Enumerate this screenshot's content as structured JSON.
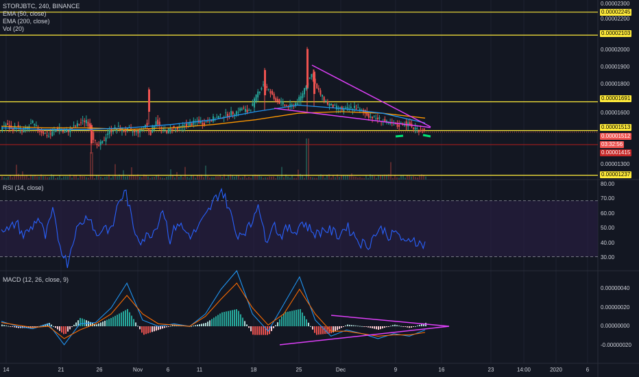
{
  "header": {
    "symbol_line": "STORJBTC, 240, BINANCE",
    "indicators": [
      "EMA (50, close)",
      "EMA (200, close)",
      "Vol (20)"
    ]
  },
  "panes": {
    "rsi_label": "RSI (14, close)",
    "macd_label": "MACD (12, 26, close, 9)"
  },
  "price_axis": {
    "ticks": [
      "0.00002300",
      "0.00002200",
      "0.00002000",
      "0.00001900",
      "0.00001800",
      "0.00001600",
      "0.00001300"
    ],
    "badges": [
      {
        "text": "0.00002245",
        "kind": "level"
      },
      {
        "text": "0.00002103",
        "kind": "level"
      },
      {
        "text": "0.00001691",
        "kind": "level"
      },
      {
        "text": "0.00001513",
        "kind": "level"
      },
      {
        "text": "0.00001512",
        "kind": "price"
      },
      {
        "text": "03:32:56",
        "kind": "price"
      },
      {
        "text": "0.00001415",
        "kind": "price"
      },
      {
        "text": "0.00001237",
        "kind": "level"
      }
    ]
  },
  "rsi_axis": {
    "ticks": [
      "80.00",
      "70.00",
      "60.00",
      "50.00",
      "40.00",
      "30.00"
    ]
  },
  "macd_axis": {
    "ticks": [
      "0.00000040",
      "0.00000020",
      "0.00000000",
      "-0.00000020"
    ]
  },
  "time_axis": {
    "ticks": [
      "14",
      "21",
      "26",
      "Nov",
      "6",
      "11",
      "18",
      "25",
      "Dec",
      "9",
      "16",
      "23",
      "14:00",
      "2020",
      "6"
    ]
  },
  "colors": {
    "background": "#131722",
    "grid": "#1e2230",
    "up": "#26a69a",
    "down": "#ef5350",
    "ema50": "#2196f3",
    "ema200": "#ff9800",
    "level_line": "#ffeb3b",
    "trendline": "#e040fb",
    "rsi_line": "#2962ff",
    "rsi_band": "#2a1e44",
    "macd_line": "#2196f3",
    "signal_line": "#ff6d00",
    "hist_up": "#b2dfdb",
    "hist_down": "#ffcdd2",
    "current_price": "#ef5350",
    "green_marks": "#00e676"
  },
  "chart_data": {
    "type": "candlestick",
    "symbol": "STORJBTC",
    "timeframe": "240",
    "exchange": "BINANCE",
    "horizontal_levels": [
      2.245e-05,
      2.103e-05,
      1.691e-05,
      1.513e-05,
      1.237e-05
    ],
    "current_price": 1.512e-05,
    "countdown": "03:32:56",
    "price_range": [
      1.21e-05,
      2.32e-05
    ],
    "candle_path_approx": [
      1.53e-05,
      1.55e-05,
      1.52e-05,
      1.54e-05,
      1.51e-05,
      1.53e-05,
      1.56e-05,
      1.52e-05,
      1.5e-05,
      1.48e-05,
      1.51e-05,
      1.53e-05,
      1.5e-05,
      1.52e-05,
      1.54e-05,
      1.56e-05,
      1.58e-05,
      1.5e-05,
      1.41e-05,
      1.44e-05,
      1.5e-05,
      1.52e-05,
      1.53e-05,
      1.51e-05,
      1.52e-05,
      1.5e-05,
      1.51e-05,
      1.55e-05,
      1.5e-05,
      1.58e-05,
      1.52e-05,
      1.51e-05,
      1.53e-05,
      1.52e-05,
      1.54e-05,
      1.55e-05,
      1.56e-05,
      1.57e-05,
      1.56e-05,
      1.58e-05,
      1.59e-05,
      1.6e-05,
      1.61e-05,
      1.62e-05,
      1.63e-05,
      1.65e-05,
      1.63e-05,
      1.67e-05,
      1.75e-05,
      1.8e-05,
      1.76e-05,
      1.71e-05,
      1.69e-05,
      1.67e-05,
      1.66e-05,
      1.68e-05,
      1.72e-05,
      1.8e-05,
      1.86e-05,
      1.77e-05,
      1.72e-05,
      1.68e-05,
      1.66e-05,
      1.65e-05,
      1.64e-05,
      1.65e-05,
      1.66e-05,
      1.64e-05,
      1.62e-05,
      1.6e-05,
      1.59e-05,
      1.58e-05,
      1.56e-05,
      1.55e-05,
      1.54e-05,
      1.56e-05,
      1.55e-05,
      1.53e-05,
      1.52e-05,
      1.51e-05
    ],
    "ema50_approx": [
      1.53e-05,
      1.52e-05,
      1.52e-05,
      1.53e-05,
      1.55e-05,
      1.58e-05,
      1.63e-05,
      1.67e-05,
      1.65e-05,
      1.62e-05,
      1.56e-05
    ],
    "ema200_approx": [
      1.54e-05,
      1.53e-05,
      1.53e-05,
      1.52e-05,
      1.53e-05,
      1.55e-05,
      1.58e-05,
      1.62e-05,
      1.63e-05,
      1.62e-05,
      1.59e-05
    ],
    "rsi": {
      "range": [
        20,
        85
      ],
      "bands": [
        30,
        70
      ],
      "values_approx": [
        52,
        48,
        55,
        45,
        50,
        58,
        44,
        62,
        38,
        25,
        47,
        55,
        60,
        44,
        52,
        48,
        70,
        76,
        50,
        42,
        45,
        50,
        65,
        42,
        55,
        48,
        45,
        52,
        60,
        70,
        78,
        65,
        46,
        48,
        52,
        70,
        40,
        55,
        45,
        50,
        48,
        55,
        50,
        46,
        50,
        48,
        45,
        52,
        46,
        40,
        38,
        47,
        50,
        44,
        48,
        38,
        44,
        39
      ]
    },
    "macd": {
      "range": [
        -3e-07,
        4.5e-07
      ],
      "macd_approx": [
        4e-08,
        0.0,
        -2e-08,
        2e-08,
        -1.5e-07,
        2e-08,
        3e-08,
        1.5e-07,
        3.5e-07,
        5e-08,
        0.0,
        2e-08,
        0.0,
        1e-07,
        3e-07,
        4.5e-07,
        1e-07,
        -4e-08,
        1.8e-07,
        4e-07,
        5e-08,
        -8e-08,
        -3e-08,
        -6e-08,
        -1e-07,
        -6e-08,
        -8e-08,
        -3e-08
      ],
      "signal_approx": [
        3e-08,
        1e-08,
        -1e-08,
        0.0,
        -1e-07,
        -3e-08,
        2e-08,
        1e-07,
        2.5e-07,
        1e-07,
        2e-08,
        1e-08,
        0.0,
        8e-08,
        2.2e-07,
        3.5e-07,
        1.5e-07,
        1e-08,
        1e-07,
        3e-07,
        1e-07,
        -4e-08,
        -4e-08,
        -6e-08,
        -8e-08,
        -7e-08,
        -7e-08,
        -5e-08
      ]
    }
  }
}
